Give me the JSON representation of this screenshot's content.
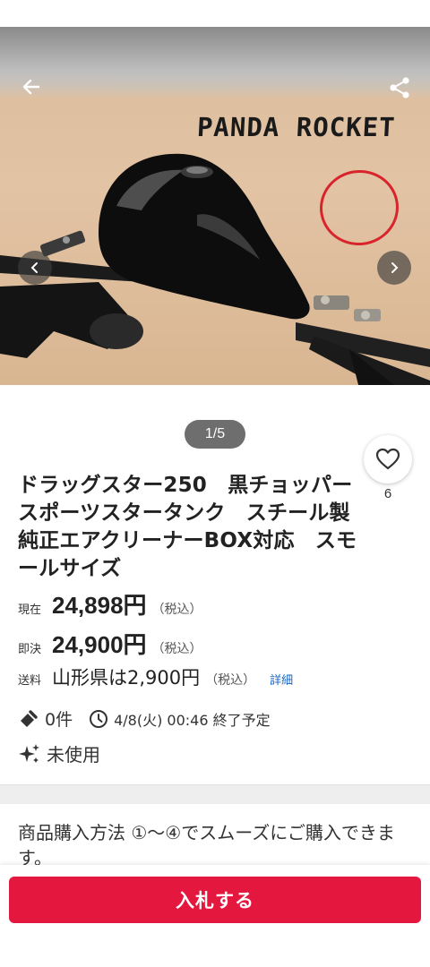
{
  "hero": {
    "brand_text": "PANDA ROCKET",
    "pager": "1/5"
  },
  "nav": {
    "back_icon": "arrow-left-icon",
    "share_icon": "share-icon"
  },
  "favorite": {
    "icon": "heart-icon",
    "count": "6"
  },
  "item": {
    "title": "ドラッグスター250　黒チョッパースポーツスタータンク　スチール製　純正エアクリーナーBOX対応　スモールサイズ",
    "current_label": "現在",
    "current_price": "24,898円",
    "current_tax": "（税込）",
    "buyout_label": "即決",
    "buyout_price": "24,900円",
    "buyout_tax": "（税込）",
    "shipping_label": "送料",
    "shipping_value": "山形県は2,900円",
    "shipping_tax": "（税込）",
    "shipping_detail": "詳細",
    "bids": "0件",
    "end_time": "4/8(火) 00:46 終了予定",
    "condition": "未使用"
  },
  "purchase": {
    "text": "商品購入方法 ①〜④でスムーズにご購入できます。"
  },
  "actions": {
    "bid_label": "入札する"
  },
  "colors": {
    "accent": "#e4183e",
    "link": "#1a66c8"
  }
}
